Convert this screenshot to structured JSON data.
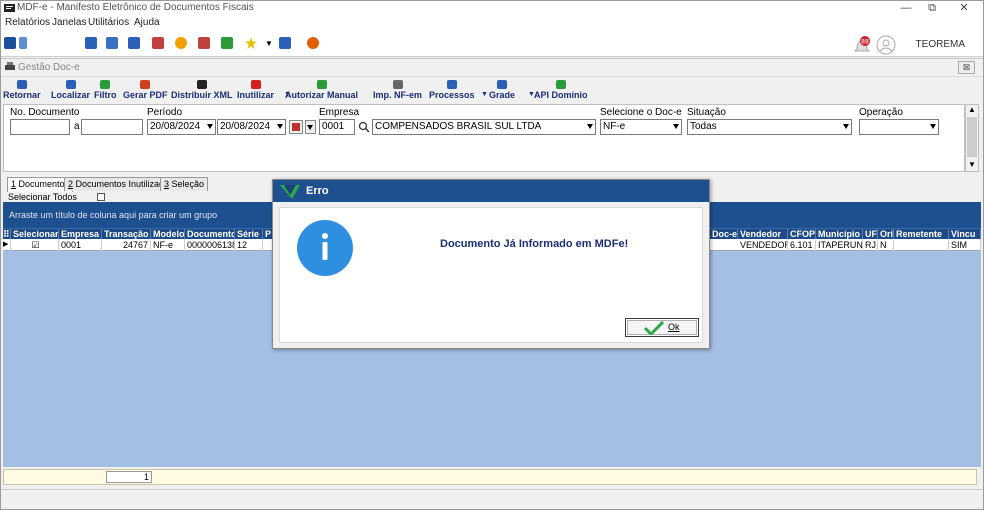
{
  "window": {
    "title": "MDF-e - Manifesto Eletrônico de Documentos Fiscais",
    "min": "—",
    "max": "⧉",
    "close": "✕"
  },
  "menu": [
    "Relatórios",
    "Janelas",
    "Utilitários",
    "Ajuda"
  ],
  "user": {
    "name": "TEOREMA"
  },
  "inner_window": {
    "title": "Gestão Doc-e",
    "close": "⊠"
  },
  "actions": [
    {
      "label": "Retornar",
      "icon": "back-arrow-icon",
      "color": "#2a60b8"
    },
    {
      "label": "Localizar",
      "icon": "magnifier-icon",
      "color": "#2a60b8"
    },
    {
      "label": "Filtro",
      "icon": "funnel-icon",
      "color": "#2a9a3a"
    },
    {
      "label": "Gerar PDF",
      "icon": "pdf-icon",
      "color": "#d04020"
    },
    {
      "label": "Distribuir XML",
      "icon": "save-icon",
      "color": "#222222"
    },
    {
      "label": "Inutilizar",
      "icon": "x-icon",
      "color": "#d02020"
    },
    {
      "label": "Autorizar Manual",
      "icon": "check-icon",
      "color": "#2a9a3a"
    },
    {
      "label": "Imp. NF-em",
      "icon": "document-icon",
      "color": "#666666"
    },
    {
      "label": "Processos",
      "icon": "refresh-icon",
      "color": "#2a60b8"
    },
    {
      "label": "Grade",
      "icon": "grid-icon",
      "color": "#2a60b8"
    },
    {
      "label": "API Domínio",
      "icon": "api-icon",
      "color": "#2a9a3a"
    }
  ],
  "filters": {
    "no_documento": {
      "label": "No. Documento",
      "from": "",
      "sep": "a",
      "to": ""
    },
    "periodo": {
      "label": "Período",
      "from": "20/08/2024",
      "to": "20/08/2024"
    },
    "empresa": {
      "label": "Empresa",
      "code": "0001",
      "name": "COMPENSADOS BRASIL SUL LTDA"
    },
    "doc_e": {
      "label": "Selecione o Doc-e",
      "value": "NF-e"
    },
    "situacao": {
      "label": "Situação",
      "value": "Todas"
    },
    "operacao": {
      "label": "Operação",
      "value": ""
    }
  },
  "tabs": [
    {
      "key": "1",
      "label": " Documentos"
    },
    {
      "key": "2",
      "label": " Documentos Inutilizados"
    },
    {
      "key": "3",
      "label": " Seleção"
    }
  ],
  "select_all": "Selecionar Todos",
  "grid": {
    "group_hint": "Arraste um título de coluna aqui para criar um grupo",
    "columns": [
      "Selecionar",
      "Empresa",
      "Transação",
      "Modelo",
      "Documento",
      "Série",
      "P",
      "Doc-e",
      "Vendedor",
      "CFOP",
      "Município",
      "UF",
      "Ori",
      "Remetente",
      "Vincu"
    ],
    "row": {
      "empresa": "0001",
      "transacao": "24767",
      "modelo": "NF-e",
      "documento": "0000006138",
      "serie": "12",
      "vendedor": "VENDEDOR",
      "cfop": "6.101",
      "municipio": "ITAPERUNA",
      "uf": "RJ",
      "ori": "N",
      "vinculo": "SIM"
    }
  },
  "footer": {
    "count": "1"
  },
  "dialog": {
    "title": "Erro",
    "message": "Documento Já Informado em MDFe!",
    "ok": "Ok"
  },
  "colors": {
    "header_blue": "#1e4f8e",
    "grid_bg": "#a4bfe3",
    "message_blue": "#1a2f77",
    "info_icon": "#2e8ee0"
  }
}
